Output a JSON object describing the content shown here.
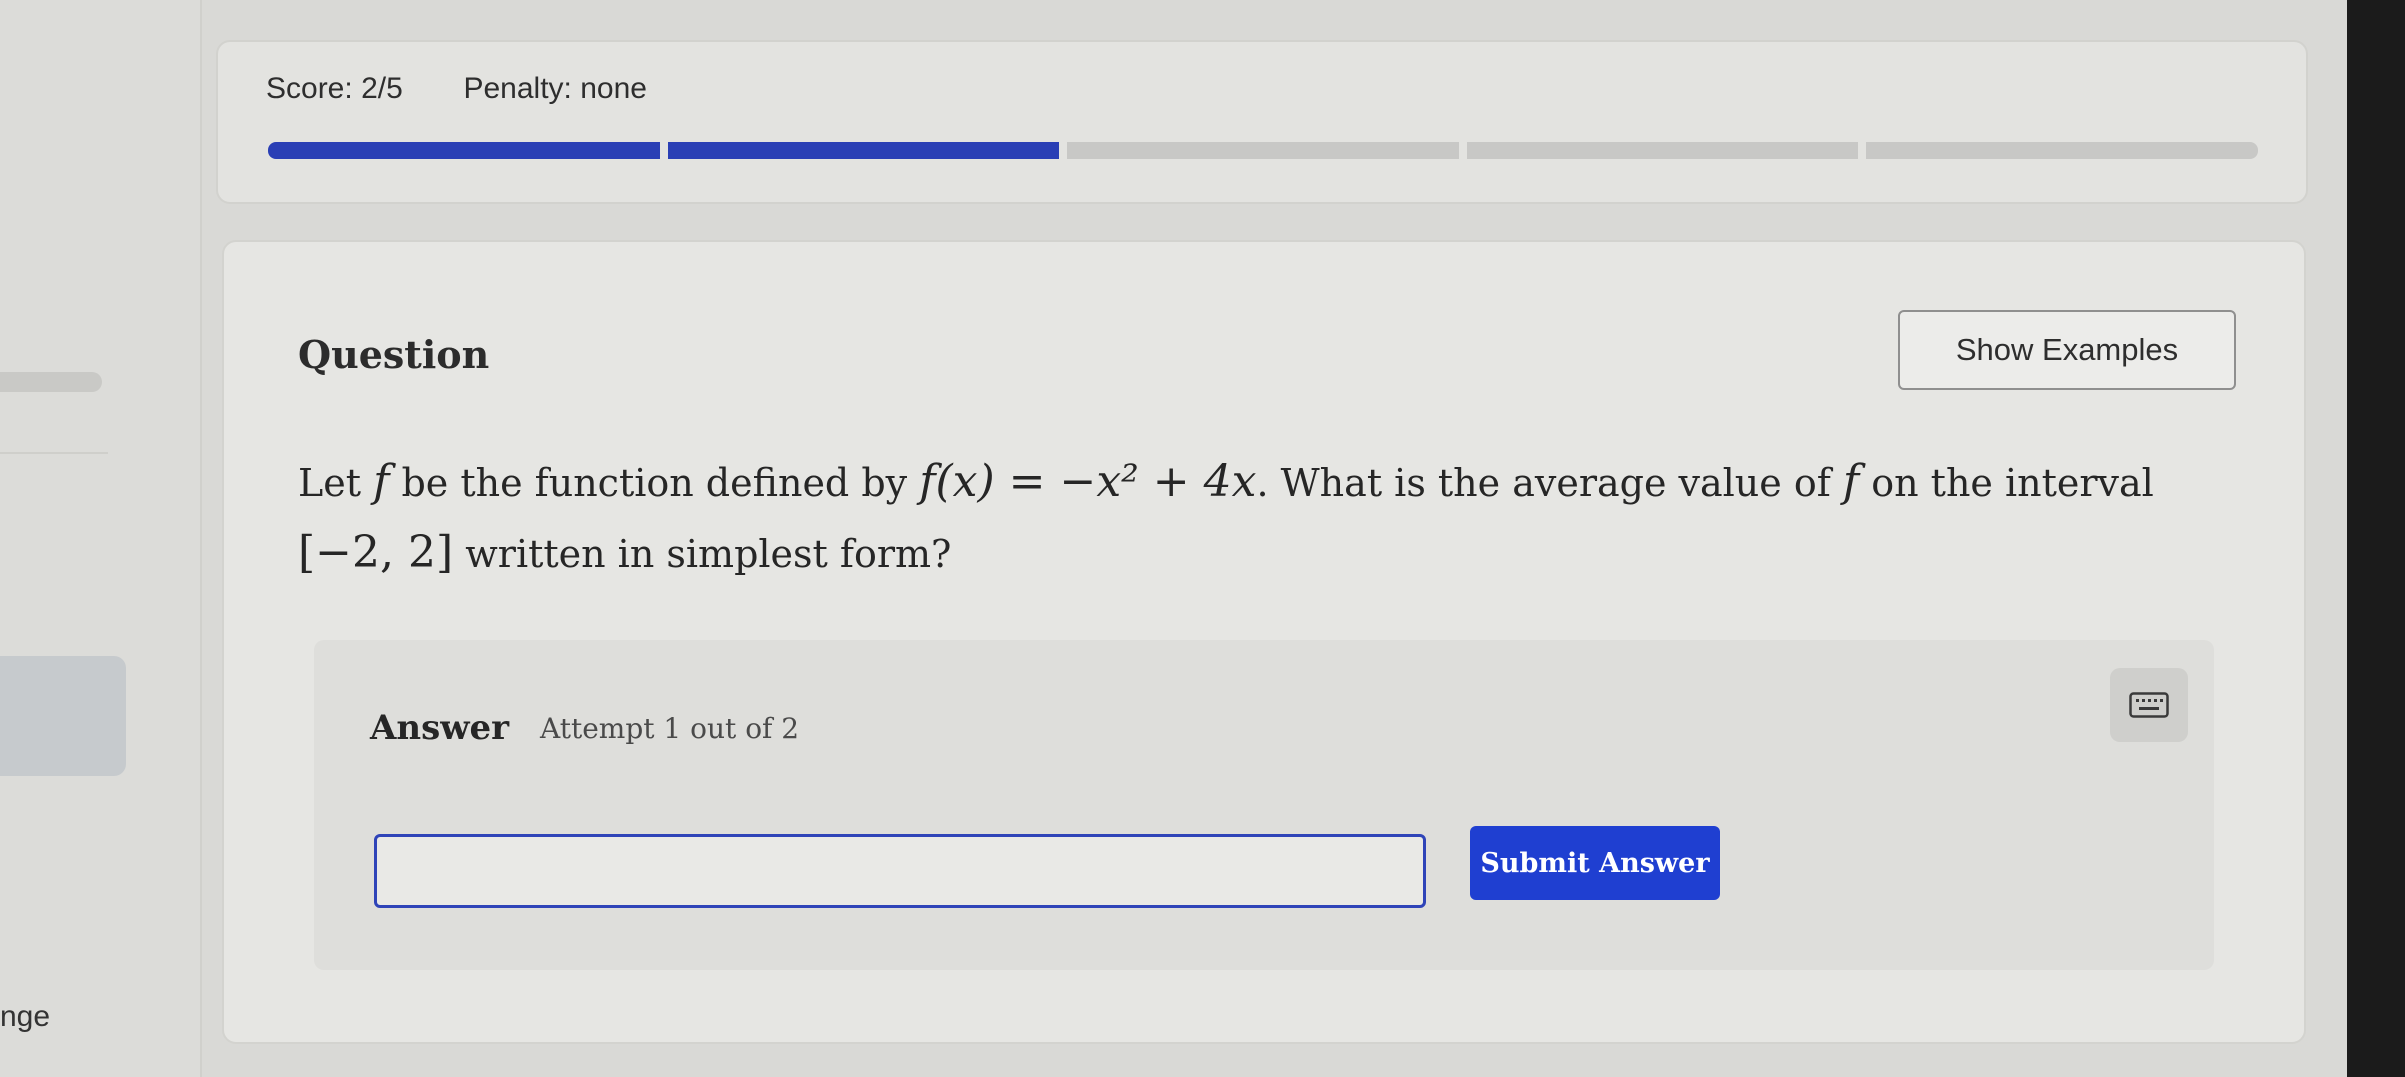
{
  "sidebar": {
    "fragment_text": "nge"
  },
  "score_bar": {
    "score_label": "Score:",
    "score_value": "2/5",
    "penalty_label": "Penalty:",
    "penalty_value": "none",
    "progress": {
      "total_segments": 5,
      "completed_segments": 2
    }
  },
  "question": {
    "heading": "Question",
    "show_examples_label": "Show Examples",
    "text": {
      "part1": "Let ",
      "f1": "f",
      "part2": " be the function defined by ",
      "formula": "f(x) = −x² + 4x",
      "part3": ". What is the average value of ",
      "f2": "f",
      "part4": " on the interval ",
      "interval": "[−2, 2]",
      "part5": " written in simplest form?"
    }
  },
  "answer": {
    "label": "Answer",
    "attempt_text": "Attempt 1 out of 2",
    "input_value": "",
    "submit_label": "Submit Answer",
    "keyboard_icon": "keyboard-icon"
  },
  "colors": {
    "progress_filled": "#2a3fb5",
    "progress_empty": "#c8c8c6",
    "submit_button": "#1f3fd1",
    "input_border": "#2f44b8"
  }
}
